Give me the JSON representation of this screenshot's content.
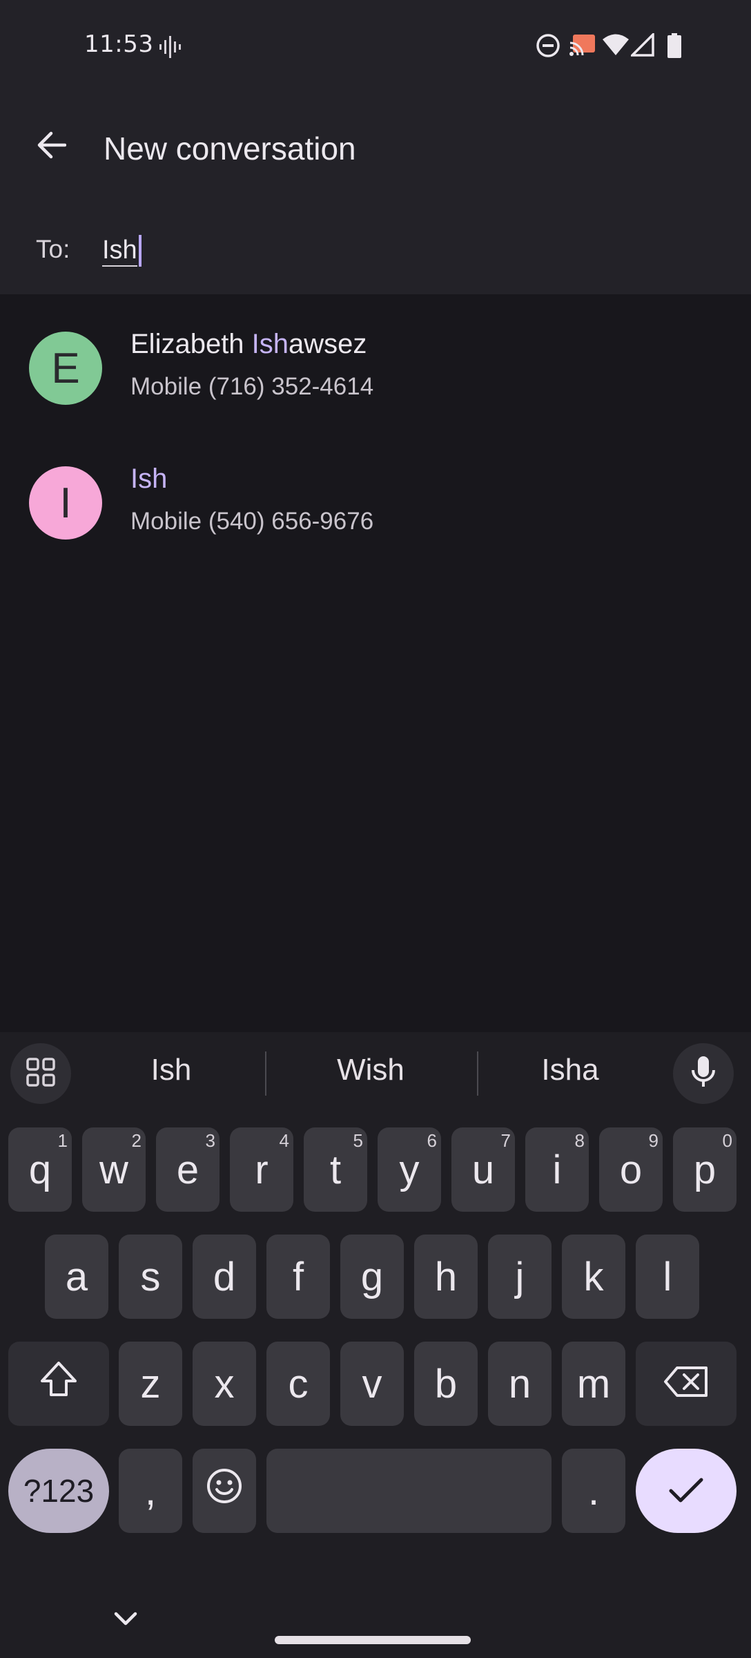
{
  "status_bar": {
    "time": "11:53",
    "icons": [
      "voice-activity-icon",
      "do-not-disturb-icon",
      "cast-icon",
      "wifi-icon",
      "signal-icon",
      "battery-icon"
    ]
  },
  "app_bar": {
    "title": "New conversation",
    "back_icon": "back-arrow-icon"
  },
  "recipient": {
    "label": "To:",
    "value": "Ish"
  },
  "contacts": [
    {
      "initial": "E",
      "avatar_color": "#81c995",
      "name_before": "Elizabeth ",
      "name_match": "Ish",
      "name_after": "awsez",
      "number": "Mobile (716) 352-4614"
    },
    {
      "initial": "I",
      "avatar_color": "#f7a8d8",
      "name_before": "",
      "name_match": "Ish",
      "name_after": "",
      "number": "Mobile (540) 656-9676"
    }
  ],
  "keyboard": {
    "suggestions": [
      "Ish",
      "Wish",
      "Isha"
    ],
    "row1": [
      {
        "k": "q",
        "h": "1"
      },
      {
        "k": "w",
        "h": "2"
      },
      {
        "k": "e",
        "h": "3"
      },
      {
        "k": "r",
        "h": "4"
      },
      {
        "k": "t",
        "h": "5"
      },
      {
        "k": "y",
        "h": "6"
      },
      {
        "k": "u",
        "h": "7"
      },
      {
        "k": "i",
        "h": "8"
      },
      {
        "k": "o",
        "h": "9"
      },
      {
        "k": "p",
        "h": "0"
      }
    ],
    "row2": [
      "a",
      "s",
      "d",
      "f",
      "g",
      "h",
      "j",
      "k",
      "l"
    ],
    "row3": [
      "z",
      "x",
      "c",
      "v",
      "b",
      "n",
      "m"
    ],
    "symbols_label": "?123",
    "comma": ",",
    "period": "."
  },
  "colors": {
    "match_highlight": "#c6b4f6",
    "header_bg": "#232228",
    "list_bg": "#18171c"
  }
}
